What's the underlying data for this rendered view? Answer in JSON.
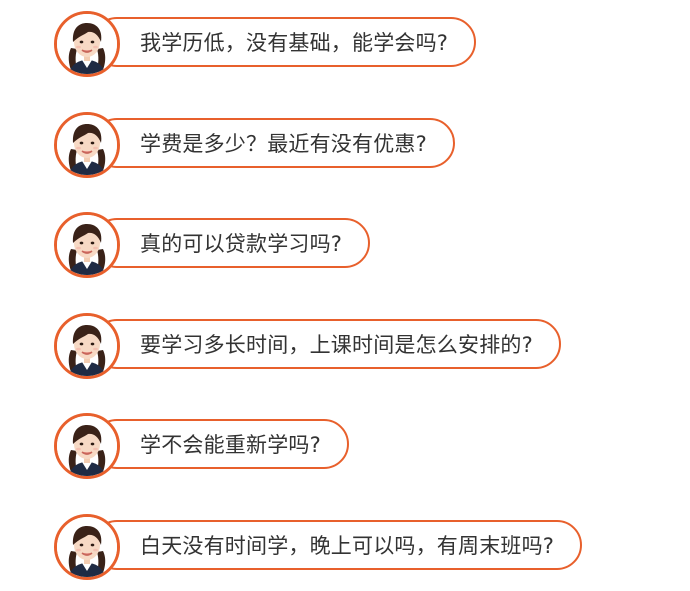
{
  "theme": {
    "accent_color": "#e8602c",
    "text_color": "#333333",
    "background": "#ffffff"
  },
  "avatar": {
    "icon": "girl-avatar-icon"
  },
  "faq": {
    "items": [
      {
        "question": "我学历低，没有基础，能学会吗?"
      },
      {
        "question": "学费是多少？最近有没有优惠?"
      },
      {
        "question": "真的可以贷款学习吗?"
      },
      {
        "question": "要学习多长时间，上课时间是怎么安排的?"
      },
      {
        "question": "学不会能重新学吗?"
      },
      {
        "question": "白天没有时间学，晚上可以吗，有周末班吗?"
      }
    ]
  }
}
